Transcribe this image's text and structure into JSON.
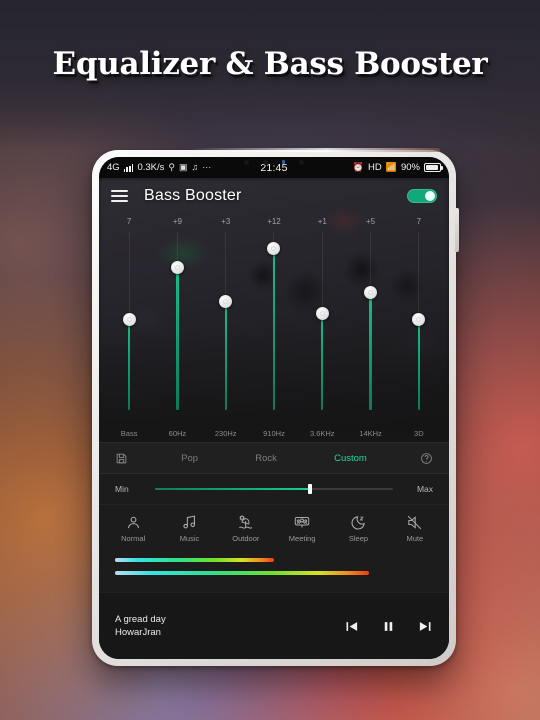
{
  "poster": {
    "title": "Equalizer & Bass Booster"
  },
  "statusbar": {
    "network": "4G",
    "speed": "0.3K/s",
    "icons_left": [
      "usb-icon",
      "screenshot-icon",
      "music-note-icon",
      "more-icon"
    ],
    "time": "21:45",
    "alarm_icon": "alarm-icon",
    "hd": "HD",
    "wifi_icon": "wifi-icon",
    "battery_percent": "90%"
  },
  "header": {
    "menu_icon": "hamburger-menu-icon",
    "title": "Bass Booster",
    "toggle_on": true
  },
  "equalizer": {
    "bands": [
      {
        "label": "Bass",
        "value": "7",
        "pct": 51
      },
      {
        "label": "60Hz",
        "value": "+9",
        "pct": 80
      },
      {
        "label": "230Hz",
        "value": "+3",
        "pct": 61
      },
      {
        "label": "910Hz",
        "value": "+12",
        "pct": 91
      },
      {
        "label": "3.6KHz",
        "value": "+1",
        "pct": 54
      },
      {
        "label": "14KHz",
        "value": "+5",
        "pct": 66
      },
      {
        "label": "3D",
        "value": "7",
        "pct": 51
      }
    ]
  },
  "presets": {
    "save_icon": "save-icon",
    "help_icon": "help-icon",
    "items": [
      {
        "label": "Pop",
        "active": false
      },
      {
        "label": "Rock",
        "active": false
      },
      {
        "label": "Custom",
        "active": true
      }
    ],
    "active_color": "#1ed99a"
  },
  "bass_slider": {
    "min_label": "Min",
    "max_label": "Max",
    "value_pct": 65
  },
  "modes": [
    {
      "label": "Normal",
      "icon": "person-icon"
    },
    {
      "label": "Music",
      "icon": "music-note-icon"
    },
    {
      "label": "Outdoor",
      "icon": "beach-umbrella-icon"
    },
    {
      "label": "Meeting",
      "icon": "meeting-people-icon"
    },
    {
      "label": "Sleep",
      "icon": "moon-sleep-icon"
    },
    {
      "label": "Mute",
      "icon": "mute-speaker-icon"
    }
  ],
  "visualizer": {
    "rows": [
      {
        "fill_pct": 50
      },
      {
        "fill_pct": 80
      }
    ]
  },
  "player": {
    "track_title": "A gread day",
    "track_artist": "HowarJran",
    "prev_icon": "previous-track-icon",
    "play_pause_icon": "pause-icon",
    "next_icon": "next-track-icon"
  }
}
